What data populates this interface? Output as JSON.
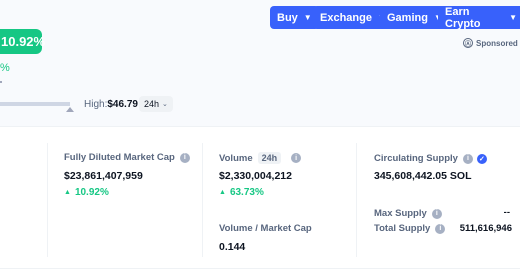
{
  "nav": {
    "buy": "Buy",
    "exchange": "Exchange",
    "gaming": "Gaming",
    "earn": "Earn Crypto",
    "caret": "▼",
    "sponsored": "Sponsored",
    "sponsored_icon_glyph": "Ⓐ"
  },
  "price": {
    "change_badge": "10.92%",
    "change_small": "%",
    "high_label": "High:",
    "high_value": "$46.79",
    "period": "24h",
    "period_chevron": "⌄"
  },
  "stats": {
    "fdmc": {
      "title": "Fully Diluted Market Cap",
      "value": "$23,861,407,959",
      "change": "10.92%",
      "change_arrow": "▲"
    },
    "volume": {
      "title": "Volume",
      "tag": "24h",
      "value": "$2,330,004,212",
      "change": "63.73%",
      "change_arrow": "▲"
    },
    "vol_mcap": {
      "title": "Volume / Market Cap",
      "value": "0.144"
    },
    "circulating": {
      "title": "Circulating Supply",
      "value": "345,608,442.05 SOL"
    },
    "max_supply": {
      "title": "Max Supply",
      "value": "--"
    },
    "total_supply": {
      "title": "Total Supply",
      "value": "511,616,946"
    }
  },
  "icons": {
    "info": "i",
    "verified": "✓"
  },
  "colors": {
    "accent": "#3861fb",
    "positive": "#16c784",
    "muted": "#58667e"
  }
}
